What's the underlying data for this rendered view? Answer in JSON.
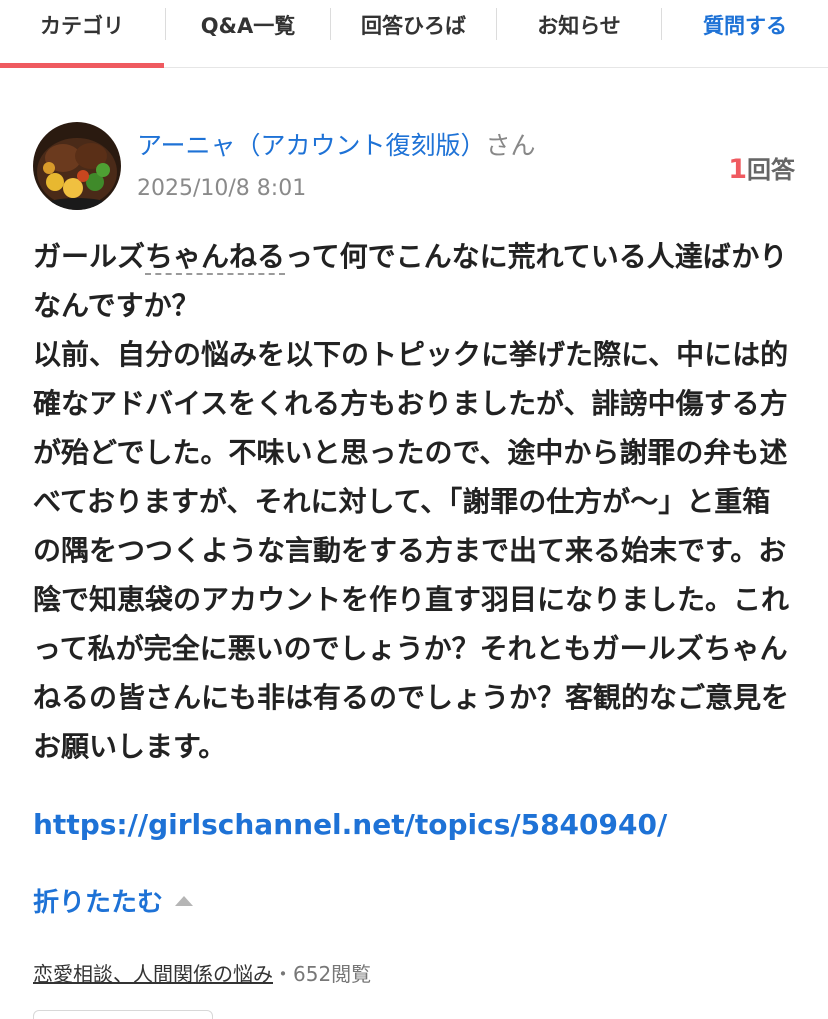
{
  "nav": {
    "tabs": [
      {
        "label": "カテゴリ"
      },
      {
        "label": "Q&A一覧"
      },
      {
        "label": "回答ひろば"
      },
      {
        "label": "お知らせ"
      },
      {
        "label": "質問する"
      }
    ],
    "active_tab": "カテゴリ"
  },
  "question": {
    "user_name": "アーニャ（アカウント復刻版）",
    "honorific": "さん",
    "avatar_icon": "user-avatar-food-photo-icon",
    "date": "2025/10/8 8:01",
    "answer_count": "1",
    "answer_label": "回答",
    "body_part1": "ガールズ",
    "body_underlined": "ちゃんねる",
    "body_part2": "って何でこんなに荒れている人達ばかりなんですか？",
    "body_paragraph": "以前、自分の悩みを以下のトピックに挙げた際に、中には的確なアドバイスをくれる方もおりましたが、誹謗中傷する方が殆どでした。不味いと思ったので、途中から謝罪の弁も述べておりますが、それに対して、「謝罪の仕方が〜」と重箱の隅をつつくような言動をする方まで出て来る始末です。お陰で知恵袋のアカウントを作り直す羽目になりました。これって私が完全に悪いのでしょうか？それともガールズちゃんねるの皆さんにも非は有るのでしょうか？客観的なご意見をお願いします。",
    "link": "https://girlschannel.net/topics/5840940/",
    "fold_label": "折りたたむ",
    "fold_icon": "triangle-up-icon",
    "category": "恋愛相談、人間関係の悩み",
    "separator": "・",
    "views": "652閲覧"
  },
  "colors": {
    "accent_blue": "#1e72d6",
    "active_tab_underline": "#ef5a60",
    "answer_count_red": "#ef5a60"
  }
}
